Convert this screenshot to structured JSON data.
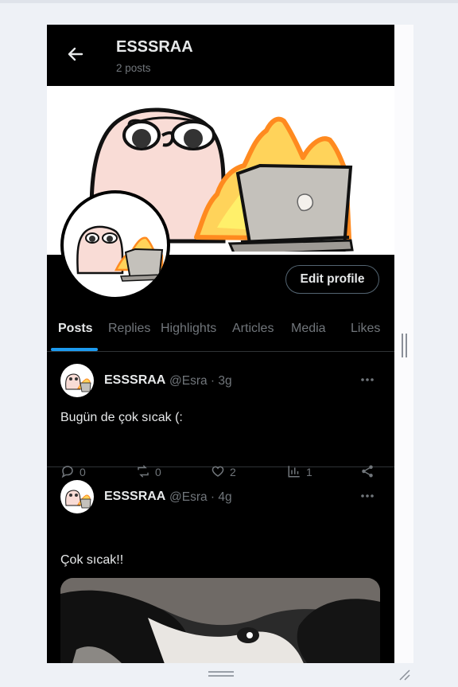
{
  "header": {
    "title": "ESSSRAA",
    "subtitle": "2 posts"
  },
  "profile": {
    "edit_button": "Edit profile"
  },
  "tabs": [
    {
      "label": "Posts",
      "active": true
    },
    {
      "label": "Replies"
    },
    {
      "label": "Highlights"
    },
    {
      "label": "Articles"
    },
    {
      "label": "Media"
    },
    {
      "label": "Likes"
    }
  ],
  "posts": [
    {
      "name": "ESSSRAA",
      "handle": "@Esra · 3g",
      "text": "Bugün de çok sıcak (:",
      "replies": "0",
      "reposts": "0",
      "likes": "2",
      "views": "1"
    },
    {
      "name": "ESSSRAA",
      "handle": "@Esra · 4g",
      "text": "Çok sıcak!!",
      "media": "dog-photo"
    }
  ],
  "colors": {
    "accent": "#1d9bf0",
    "background": "#000000",
    "muted": "#71767b",
    "text": "#e7e9ea"
  },
  "icons": [
    "back-arrow-icon",
    "more-icon",
    "reply-icon",
    "repost-icon",
    "like-icon",
    "views-icon",
    "share-icon"
  ]
}
